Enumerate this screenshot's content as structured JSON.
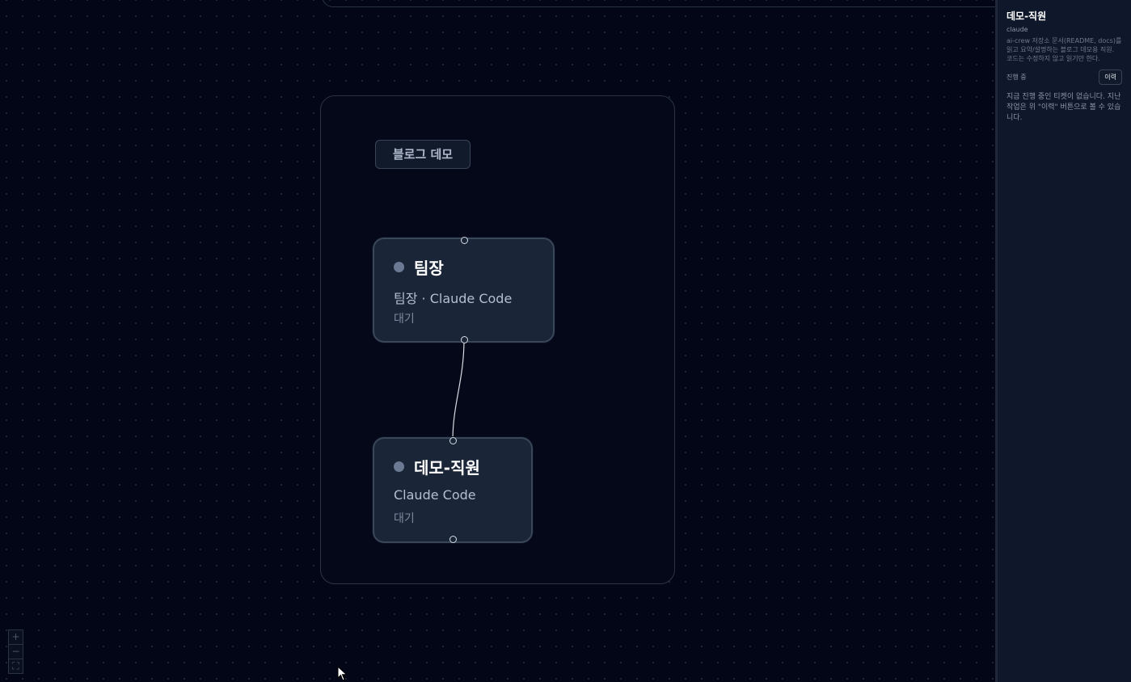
{
  "group": {
    "label": "블로그 데모"
  },
  "nodes": [
    {
      "title": "팀장",
      "subtitle": "팀장 · Claude Code",
      "status": "대기"
    },
    {
      "title": "데모-직원",
      "subtitle": "Claude Code",
      "status": "대기"
    }
  ],
  "zoom_controls": {
    "zoom_in": "+",
    "zoom_out": "−",
    "fit": "⛶"
  },
  "panel": {
    "title": "데모-직원",
    "subtitle": "claude",
    "description": "ai-crew 저장소 문서(README, docs)를 읽고 요약/설명하는 블로그 데모용 직원. 코드는 수정하지 않고 읽기만 한다.",
    "status_label": "진행 중",
    "history_button": "이력",
    "empty_message": "지금 진행 중인 티켓이 없습니다. 지난 작업은 위 \"이력\" 버튼으로 볼 수 있습니다."
  },
  "colors": {
    "background": "#030617",
    "node_fill": "#1a2537",
    "status_idle": "#6b7a92",
    "panel_bg": "#0f172a"
  },
  "icons": {
    "cursor": "arrow-cursor-icon",
    "status": "status-dot-icon"
  }
}
